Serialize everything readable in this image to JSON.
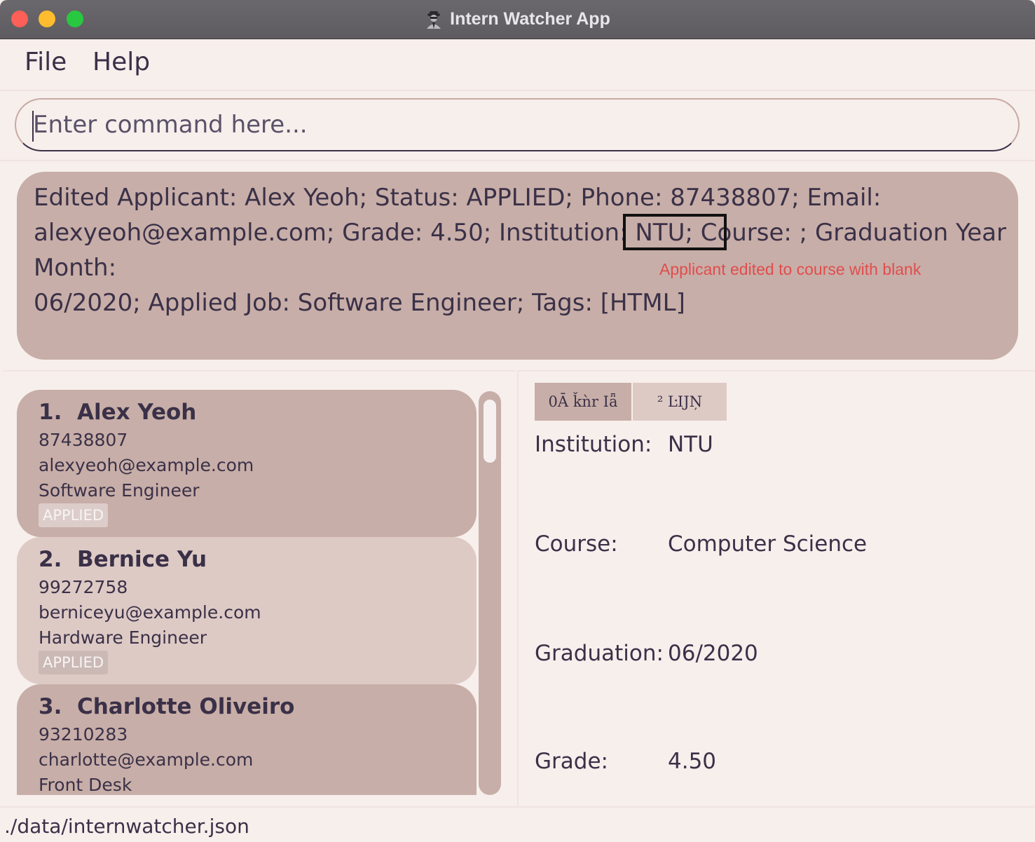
{
  "window": {
    "title": "Intern Watcher App",
    "app_icon": "spy-agent-icon"
  },
  "menu": {
    "file": "File",
    "help": "Help"
  },
  "command": {
    "placeholder": "Enter command here...",
    "value": ""
  },
  "result": {
    "lines": [
      "Edited Applicant: Alex Yeoh; Status: APPLIED; Phone: 87438807; Email:",
      "alexyeoh@example.com; Grade: 4.50; Institution: NTU; Course: ; Graduation Year Month:",
      "06/2020; Applied Job: Software Engineer; Tags: [HTML]"
    ],
    "annotation": "Applicant edited to course with blank"
  },
  "applicants": [
    {
      "index": "1.",
      "name": "Alex Yeoh",
      "phone": "87438807",
      "email": "alexyeoh@example.com",
      "job": "Software Engineer",
      "status": "APPLIED"
    },
    {
      "index": "2.",
      "name": "Bernice Yu",
      "phone": "99272758",
      "email": "berniceyu@example.com",
      "job": "Hardware Engineer",
      "status": "APPLIED"
    },
    {
      "index": "3.",
      "name": "Charlotte Oliveiro",
      "phone": "93210283",
      "email": "charlotte@example.com",
      "job": "Front Desk"
    }
  ],
  "detail": {
    "tabs": [
      "0Ā ǩǹr Iǟ",
      "² ĿĲŅ"
    ],
    "fields": [
      {
        "label": "Institution:",
        "value": "NTU"
      },
      {
        "label": "Course:",
        "value": "Computer Science"
      },
      {
        "label": "Graduation:",
        "value": "06/2020"
      },
      {
        "label": "Grade:",
        "value": "4.50"
      }
    ]
  },
  "status_bar": {
    "path": "./data/internwatcher.json"
  },
  "colors": {
    "background": "#f7efec",
    "card": "#c8aea8",
    "card_alt": "#decac5",
    "text": "#3a3148",
    "annotation": "#e04d4d"
  }
}
